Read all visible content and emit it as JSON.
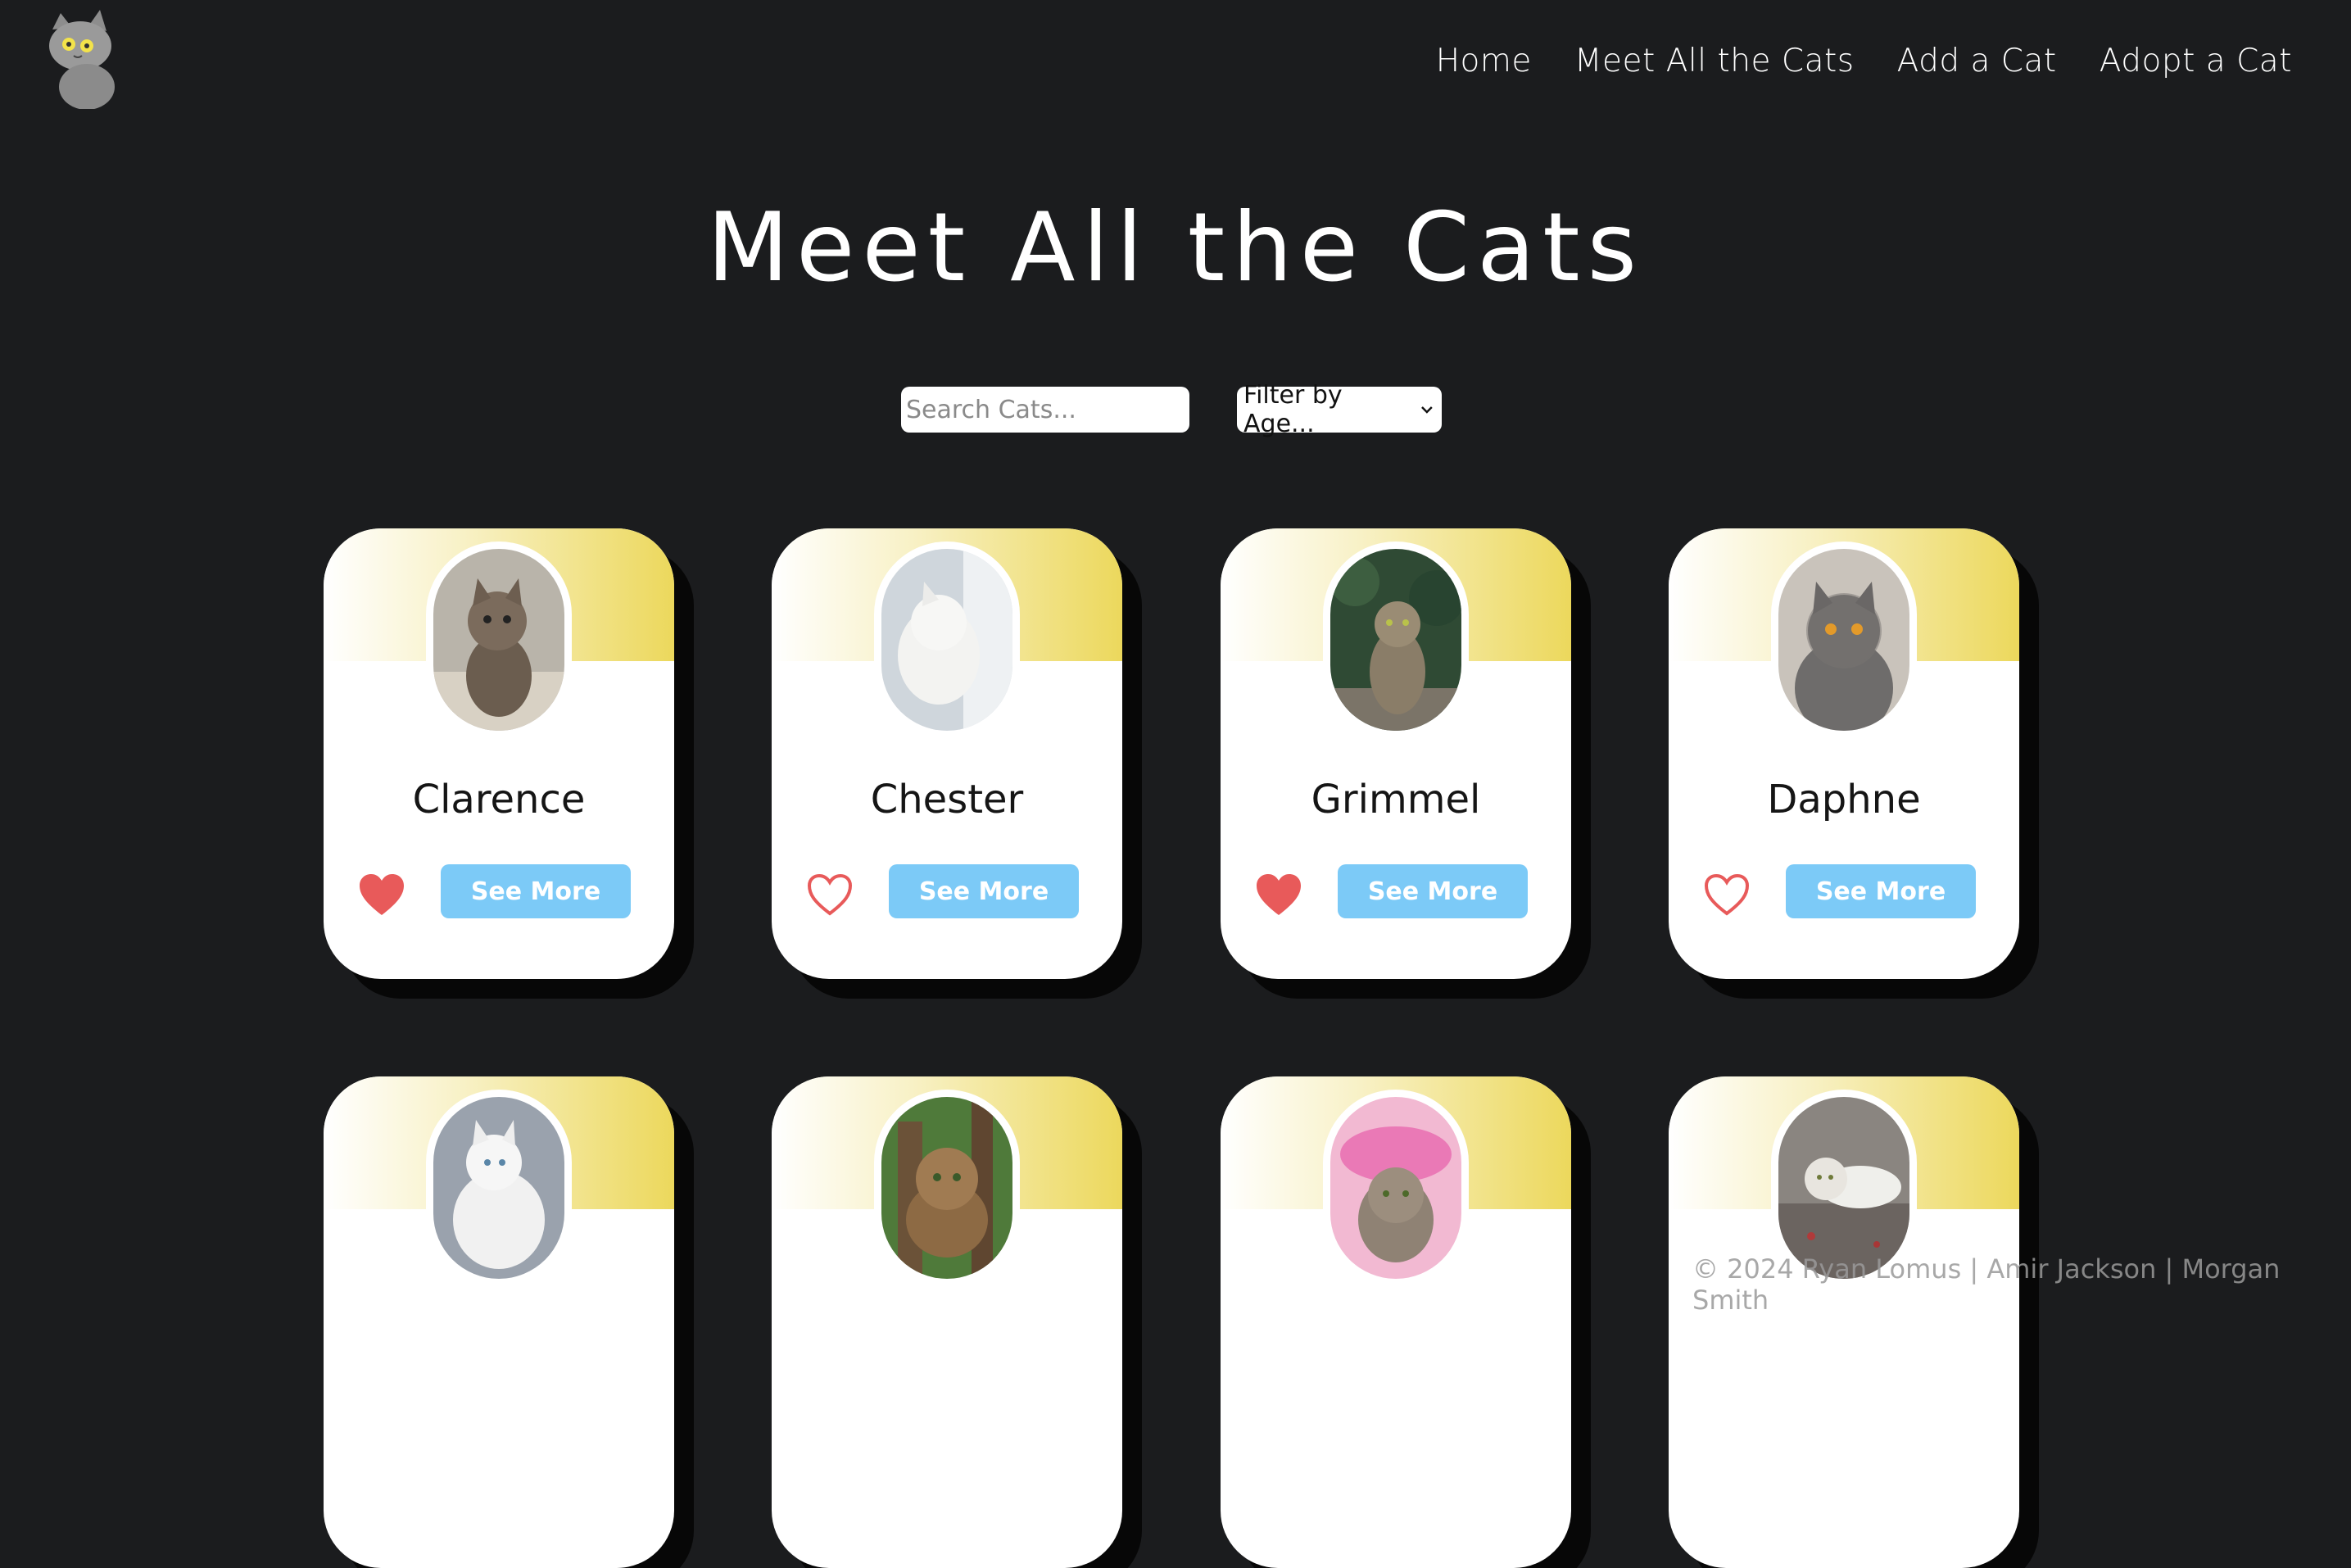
{
  "nav": {
    "logo_icon": "cat-logo-icon",
    "items": [
      "Home",
      "Meet All the Cats",
      "Add a Cat",
      "Adopt a Cat"
    ]
  },
  "page_title": "Meet All the Cats",
  "search": {
    "placeholder": "Search Cats..."
  },
  "age_filter": {
    "selected": "Filter by Age...",
    "icon": "chevron-down-icon"
  },
  "cards": [
    {
      "name": "Clarence",
      "favorited": true,
      "button": "See More"
    },
    {
      "name": "Chester",
      "favorited": false,
      "button": "See More"
    },
    {
      "name": "Grimmel",
      "favorited": true,
      "button": "See More"
    },
    {
      "name": "Daphne",
      "favorited": false,
      "button": "See More"
    },
    {
      "name": "",
      "favorited": false,
      "button": ""
    },
    {
      "name": "",
      "favorited": false,
      "button": ""
    },
    {
      "name": "",
      "favorited": false,
      "button": ""
    },
    {
      "name": "",
      "favorited": false,
      "button": ""
    }
  ],
  "footer": {
    "credit": "© 2024 Ryan Lomus | Amir Jackson | Morgan Smith"
  },
  "colors": {
    "background": "#1b1c1e",
    "accent_yellow": "#ecd85c",
    "button_blue": "#7ccaf7",
    "heart_red": "#e85a5a"
  }
}
